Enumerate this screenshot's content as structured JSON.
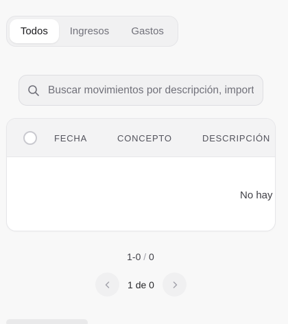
{
  "tabs": [
    {
      "label": "Todos",
      "active": true
    },
    {
      "label": "Ingresos",
      "active": false
    },
    {
      "label": "Gastos",
      "active": false
    }
  ],
  "search": {
    "placeholder": "Buscar movimientos por descripción, importe...",
    "value": "",
    "icon": "search-icon"
  },
  "table": {
    "columns": [
      "FECHA",
      "CONCEPTO",
      "DESCRIPCIÓN"
    ],
    "empty_text": "No hay"
  },
  "pagination": {
    "range_start_end": "1-0",
    "separator": "/",
    "total": "0",
    "page_label": "1 de 0",
    "prev_icon": "chevron-left-icon",
    "next_icon": "chevron-right-icon"
  },
  "colors": {
    "background": "#f8f8f8",
    "tab_active_bg": "#ffffff",
    "muted_text": "#71717a"
  }
}
